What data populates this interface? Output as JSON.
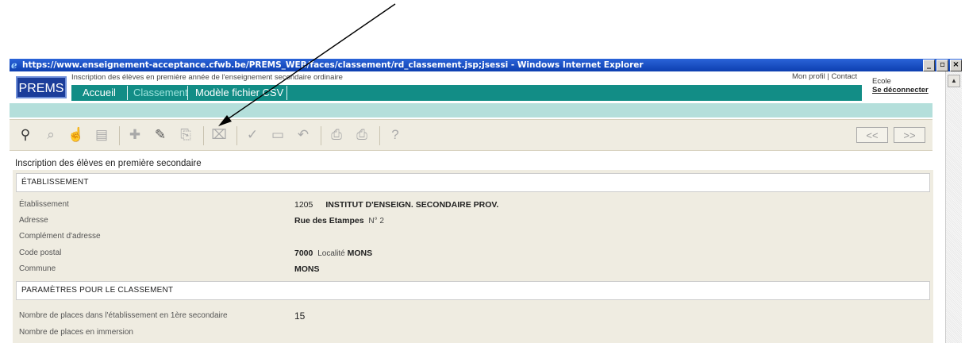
{
  "window": {
    "title": "https://www.enseignement-acceptance.cfwb.be/PREMS_WEB/faces/classement/rd_classement.jsp;jsessi - Windows Internet Explorer"
  },
  "header": {
    "logo": "PREMS",
    "subtitle": "Inscription des élèves en première année de l'enseignement secondaire ordinaire",
    "nav": [
      "Accueil",
      "Classement",
      "Modèle fichier CSV"
    ],
    "links": "Mon profil | Contact",
    "user": "Ecole",
    "logout": "Se déconnecter"
  },
  "toolbar": {
    "icons": [
      "binoculars-icon",
      "search-icon",
      "hand-icon",
      "document-icon",
      "add-icon",
      "pencil-icon",
      "copy-icon",
      "delete-icon",
      "check-icon",
      "save-icon",
      "undo-icon",
      "preview-icon",
      "print-icon",
      "help-icon"
    ],
    "prev": "<<",
    "next": ">>"
  },
  "page": {
    "title": "Inscription des élèves en première secondaire"
  },
  "sections": {
    "etablissement": {
      "heading": "ÉTABLISSEMENT",
      "rows": {
        "etab": {
          "label": "Établissement",
          "code": "1205",
          "name": "INSTITUT D'ENSEIGN. SECONDAIRE PROV."
        },
        "adresse": {
          "label": "Adresse",
          "street": "Rue des Etampes",
          "number": "N° 2"
        },
        "complement": {
          "label": "Complément d'adresse"
        },
        "codepostal": {
          "label": "Code postal",
          "code": "7000",
          "localite_label": "Localité",
          "localite": "MONS"
        },
        "commune": {
          "label": "Commune",
          "value": "MONS"
        }
      }
    },
    "parametres": {
      "heading": "PARAMÈTRES POUR LE CLASSEMENT",
      "rows": {
        "places": {
          "label": "Nombre de places dans l'établissement en 1ère secondaire",
          "value": "15"
        },
        "immersion": {
          "label": "Nombre de places en immersion"
        }
      }
    }
  }
}
